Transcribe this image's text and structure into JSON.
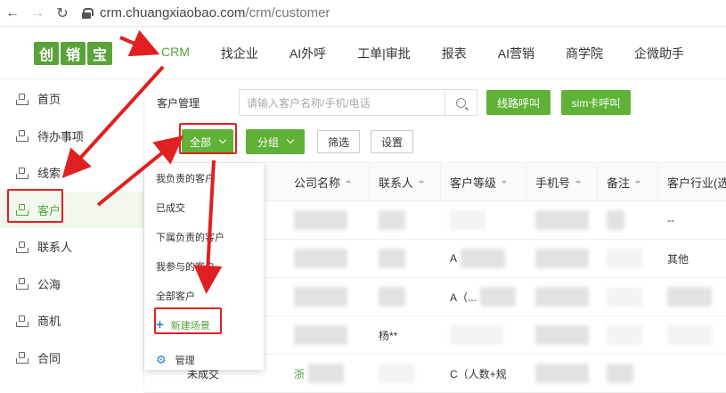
{
  "browser": {
    "url_host": "crm.chuangxiaobao.com",
    "url_path": "/crm/customer"
  },
  "logo": {
    "chars": [
      "创",
      "销",
      "宝"
    ]
  },
  "topnav": {
    "items": [
      "CRM",
      "找企业",
      "AI外呼",
      "工单|审批",
      "报表",
      "AI营销",
      "商学院",
      "企微助手"
    ],
    "active": "CRM"
  },
  "sidebar": {
    "items": [
      "首页",
      "待办事项",
      "线索",
      "客户",
      "联系人",
      "公海",
      "商机",
      "合同"
    ],
    "active": "客户"
  },
  "toolbar": {
    "label": "客户管理",
    "search_placeholder": "请输入客户名称/手机/电话",
    "line_call": "线路呼叫",
    "sim_call": "sim卡呼叫",
    "scope": "全部",
    "group": "分组",
    "filter": "筛选",
    "settings": "设置"
  },
  "table": {
    "headers": [
      "公司名称",
      "联系人",
      "客户等级",
      "手机号",
      "备注",
      "客户行业(选"
    ],
    "rows": [
      {
        "company": "",
        "contact": "",
        "level": "",
        "phone": "",
        "note": "",
        "industry": "--"
      },
      {
        "company": "",
        "contact": "",
        "level": "A",
        "phone": "",
        "note": "",
        "industry": "其他"
      },
      {
        "company": "",
        "contact": "",
        "level": "A（...",
        "phone": "",
        "note": "",
        "industry": ""
      },
      {
        "company": "",
        "contact": "杨**",
        "level": "",
        "phone": "",
        "note": "",
        "industry": ""
      },
      {
        "prefix": "未成交",
        "company": "浙",
        "contact": "",
        "level": "C（人数+规",
        "phone": "",
        "note": "",
        "industry": ""
      }
    ]
  },
  "dropdown": {
    "items": [
      "我负责的客户",
      "已成交",
      "下属负责的客户",
      "我参与的客户",
      "全部客户"
    ],
    "add_scene": "新建场景",
    "manage": "管理"
  },
  "colors": {
    "accent": "#5fb236",
    "annotation": "#e02020",
    "link_blue": "#2a7fd4"
  }
}
